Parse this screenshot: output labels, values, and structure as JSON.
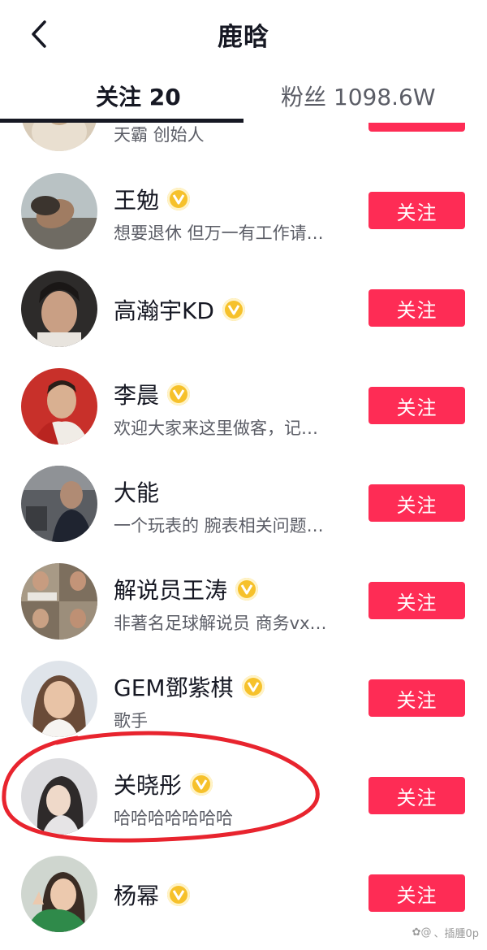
{
  "header": {
    "title": "鹿晗",
    "back_icon": "chevron-left-icon"
  },
  "tabs": {
    "following": "关注 20",
    "fans": "粉丝 1098.6W"
  },
  "partial_row": {
    "bio": "天霸 创始人",
    "button": "关注"
  },
  "users": [
    {
      "name": "王勉",
      "verified": true,
      "bio": "想要退休 但万一有工作请…",
      "button": "关注"
    },
    {
      "name": "高瀚宇KD",
      "verified": true,
      "bio": "",
      "button": "关注"
    },
    {
      "name": "李晨",
      "verified": true,
      "bio": "欢迎大家来这里做客，记…",
      "button": "关注"
    },
    {
      "name": "大能",
      "verified": false,
      "bio": "一个玩表的 腕表相关问题…",
      "button": "关注"
    },
    {
      "name": "解说员王涛",
      "verified": true,
      "bio": "非著名足球解说员 商务vx…",
      "button": "关注"
    },
    {
      "name": "GEM鄧紫棋",
      "verified": true,
      "bio": "歌手",
      "button": "关注"
    },
    {
      "name": "关晓彤",
      "verified": true,
      "bio": "哈哈哈哈哈哈哈",
      "button": "关注"
    },
    {
      "name": "杨幂",
      "verified": true,
      "bio": "",
      "button": "关注"
    }
  ],
  "colors": {
    "follow_button": "#fe2c55",
    "verified_badge": "#f6c12b",
    "annotation_circle": "#e8242e"
  },
  "watermark": "、插腫0p"
}
